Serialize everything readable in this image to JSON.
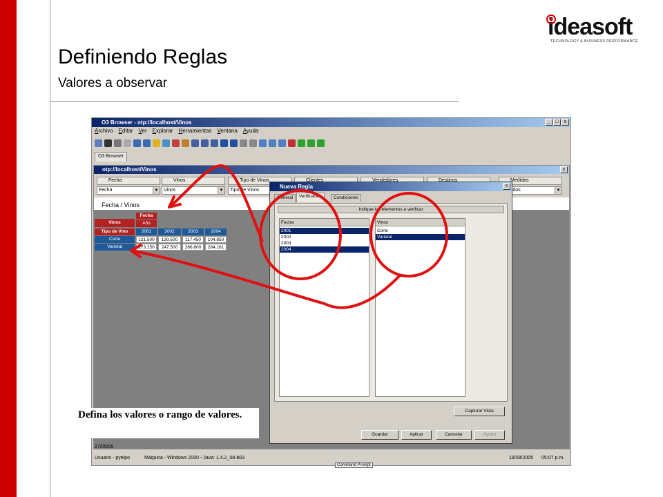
{
  "slide": {
    "title": "Definiendo Reglas",
    "subtitle": "Valores a observar",
    "logo_text": "ideasoft",
    "logo_tagline": "TECHNOLOGY & BUSINESS PERFORMANCE",
    "instruction": "Defina los valores o rango de valores."
  },
  "app": {
    "window_title": "O3 Browser - otp://localhost/Vinos",
    "menu": [
      "Archivo",
      "Editar",
      "Ver",
      "Explorar",
      "Herramientas",
      "Ventana",
      "Ayuda"
    ],
    "tab": "O3 Browser",
    "window_buttons": [
      "_",
      "□",
      "x"
    ]
  },
  "inner": {
    "window_title": "otp://localhost/Vinos",
    "dimensions": [
      {
        "label": "Fecha",
        "selected": "Fecha"
      },
      {
        "label": "Vinos",
        "selected": "Vinos"
      },
      {
        "label": "Tipo de Vinos",
        "selected": "Tipo de Vinos"
      },
      {
        "label": "Clientes",
        "selected": ""
      },
      {
        "label": "Vendedores",
        "selected": ""
      },
      {
        "label": "Destinos",
        "selected": ""
      },
      {
        "label": "Medidas",
        "selected": "Vendidos"
      }
    ],
    "view_label": "Fecha / Vinos"
  },
  "pivot": {
    "col_dim": "Fecha",
    "col_level": "Año",
    "row_dim": "Vinos",
    "years": [
      "2001",
      "2002",
      "2003",
      "2004"
    ],
    "rows": [
      {
        "label": "Tipo de Vino",
        "values": [
          "",
          "",
          "",
          ""
        ]
      },
      {
        "label": "Corte",
        "values": [
          "121.500",
          "130.500",
          "117.450",
          "104.850"
        ]
      },
      {
        "label": "Varietal",
        "values": [
          "273.150",
          "247.500",
          "266.800",
          "284.161"
        ]
      }
    ]
  },
  "dialog": {
    "title": "Nueva Regla",
    "tabs": [
      "General",
      "Verificación",
      "Condiciones"
    ],
    "active_tab": "Verificación",
    "instruction": "Indique los elementos a verificar",
    "list_fecha": {
      "header": "Fecha",
      "items": [
        {
          "label": "2001",
          "selected": true
        },
        {
          "label": "2002",
          "selected": false
        },
        {
          "label": "2003",
          "selected": false
        },
        {
          "label": "2004",
          "selected": true
        }
      ]
    },
    "list_vinos": {
      "header": "Vinos",
      "items": [
        {
          "label": "Corte",
          "selected": false
        },
        {
          "label": "Varietal",
          "selected": true
        }
      ]
    },
    "capture_button": "Capturar Vista",
    "buttons": {
      "save": "Guardar",
      "apply": "Aplicar",
      "cancel": "Cancelar",
      "help": "Ayuda"
    }
  },
  "status": {
    "date_left": "27/05/05",
    "user": "Usuario - pyelpo",
    "machine": "Máquina - Windows 2000 - Java: 1.4.2_08-b03",
    "date_right": "19/08/2005",
    "time": "05:07 p.m.",
    "taskbar_item": "Command Prompt"
  },
  "colors": {
    "accent_red": "#cc0000",
    "annotation_red": "#e01010",
    "selection": "#0a246a",
    "pivot_header": "#b22222",
    "pivot_blue": "#1e5a9a"
  }
}
